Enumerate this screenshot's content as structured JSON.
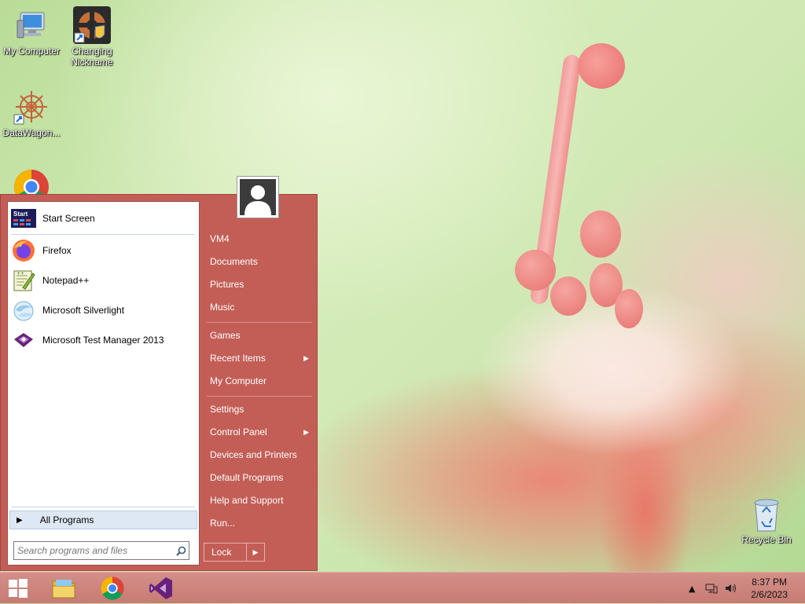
{
  "desktop": {
    "icons": [
      {
        "label": "My Computer",
        "icon": "computer-icon"
      },
      {
        "label": "Changing Nickname",
        "icon": "app-shortcut-icon"
      },
      {
        "label": "DataWagon...",
        "icon": "datawagon-icon"
      },
      {
        "label": "Google Chrome",
        "icon": "chrome-icon"
      },
      {
        "label": "Recycle Bin",
        "icon": "recycle-bin-icon"
      }
    ]
  },
  "start_menu": {
    "pinned": [
      {
        "label": "Start Screen",
        "icon": "start-screen-icon"
      },
      {
        "label": "Firefox",
        "icon": "firefox-icon"
      },
      {
        "label": "Notepad++",
        "icon": "notepadpp-icon"
      },
      {
        "label": "Microsoft Silverlight",
        "icon": "silverlight-icon"
      },
      {
        "label": "Microsoft Test Manager 2013",
        "icon": "test-manager-icon"
      }
    ],
    "start_screen_badge": "Start",
    "all_programs": "All Programs",
    "search_placeholder": "Search programs and files",
    "right": {
      "user": "VM4",
      "documents": "Documents",
      "pictures": "Pictures",
      "music": "Music",
      "games": "Games",
      "recent_items": "Recent Items",
      "my_computer": "My Computer",
      "settings": "Settings",
      "control_panel": "Control Panel",
      "devices_printers": "Devices and Printers",
      "default_programs": "Default Programs",
      "help_support": "Help and Support",
      "run": "Run..."
    },
    "lock_label": "Lock"
  },
  "taskbar": {
    "clock_time": "8:37 PM",
    "clock_date": "2/6/2023"
  }
}
